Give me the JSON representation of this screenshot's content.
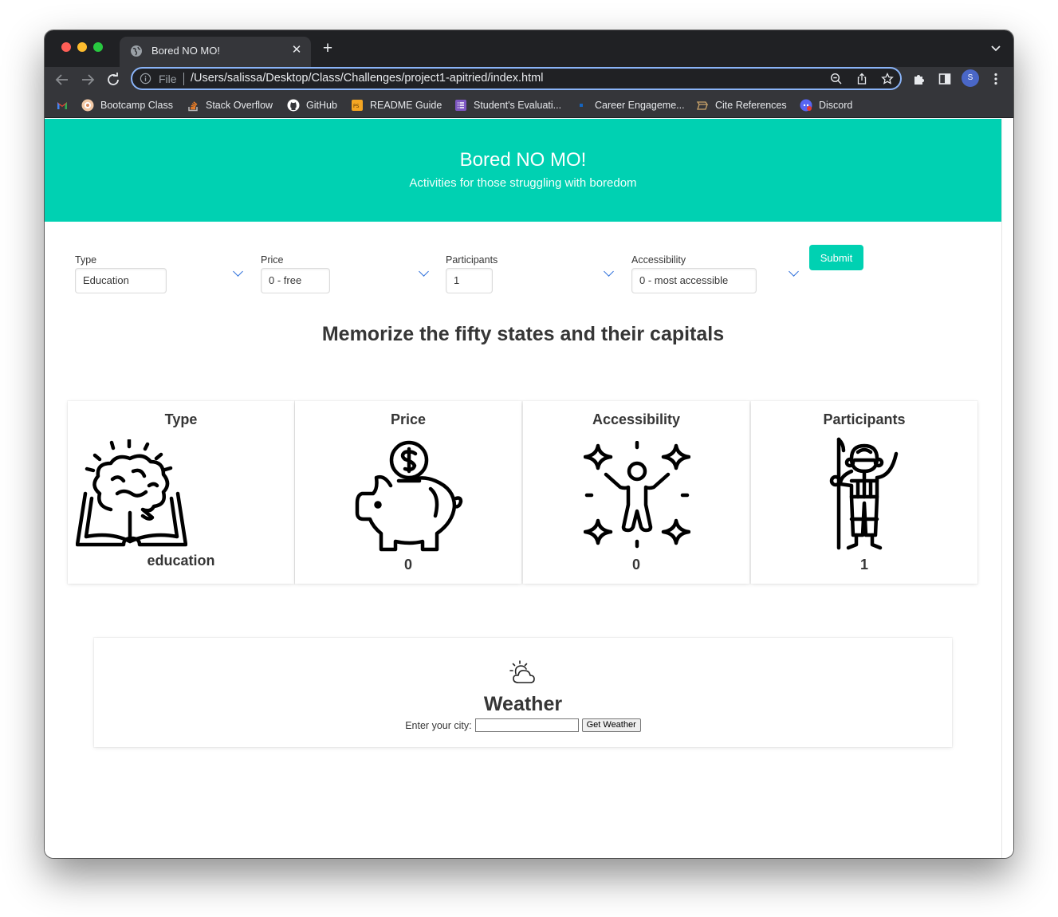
{
  "browser": {
    "tab_title": "Bored NO MO!",
    "new_tab": "+",
    "close": "✕",
    "url_scheme": "File",
    "url": "/Users/salissa/Desktop/Class/Challenges/project1-apitried/index.html",
    "profile_initial": "S",
    "bookmarks": [
      {
        "label": "",
        "icon": "gmail-icon",
        "color": "#ea4335"
      },
      {
        "label": "Bootcamp Class",
        "icon": "bootcamp-icon",
        "color": "#f2c9a6"
      },
      {
        "label": "Stack Overflow",
        "icon": "stackoverflow-icon",
        "color": "#f48024"
      },
      {
        "label": "GitHub",
        "icon": "github-icon",
        "color": "#ffffff"
      },
      {
        "label": "README Guide",
        "icon": "readme-icon",
        "color": "#f5a623"
      },
      {
        "label": "Student's Evaluati...",
        "icon": "forms-icon",
        "color": "#7e57c2"
      },
      {
        "label": "Career Engageme...",
        "icon": "career-icon",
        "color": "#1565c0"
      },
      {
        "label": "Cite References",
        "icon": "cite-icon",
        "color": "#c9a36b"
      },
      {
        "label": "Discord",
        "icon": "discord-icon",
        "color": "#5865f2"
      }
    ]
  },
  "hero": {
    "title": "Bored NO MO!",
    "subtitle": "Activities for those struggling with boredom",
    "color": "#00d1b2"
  },
  "filters": {
    "type": {
      "label": "Type",
      "value": "Education"
    },
    "price": {
      "label": "Price",
      "value": "0 - free"
    },
    "participants": {
      "label": "Participants",
      "value": "1"
    },
    "accessibility": {
      "label": "Accessibility",
      "value": "0 - most accessible"
    },
    "submit_label": "Submit"
  },
  "activity": "Memorize the fifty states and their capitals",
  "cards": {
    "type": {
      "title": "Type",
      "value": "education",
      "icon": "brain-book-icon"
    },
    "price": {
      "title": "Price",
      "value": "0",
      "icon": "piggy-bank-icon"
    },
    "accessibility": {
      "title": "Accessibility",
      "value": "0",
      "icon": "sparkle-person-icon"
    },
    "participants": {
      "title": "Participants",
      "value": "1",
      "icon": "astronaut-icon"
    }
  },
  "weather": {
    "icon": "partly-cloudy-icon",
    "title": "Weather",
    "prompt": "Enter your city:",
    "input_value": "",
    "button_label": "Get Weather"
  }
}
